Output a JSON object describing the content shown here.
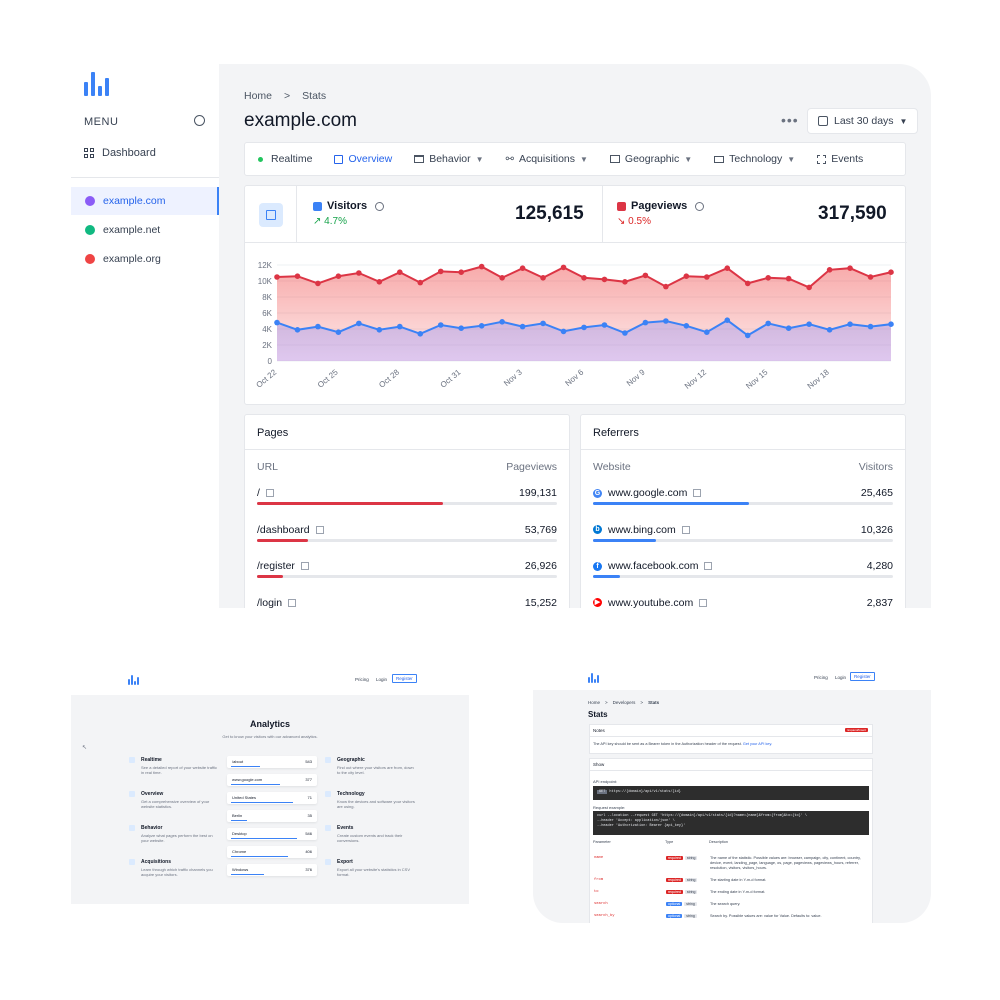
{
  "colors": {
    "accent": "#3b82f6",
    "visitors": "#3b82f6",
    "pageviews": "#dc3545",
    "panel_bg": "#f3f4f6"
  },
  "sidebar": {
    "menu_label": "MENU",
    "dashboard_label": "Dashboard",
    "sites": [
      {
        "label": "example.com",
        "color": "#8b5cf6",
        "active": true
      },
      {
        "label": "example.net",
        "color": "#10b981",
        "active": false
      },
      {
        "label": "example.org",
        "color": "#ef4444",
        "active": false
      }
    ]
  },
  "header": {
    "breadcrumb_home": "Home",
    "breadcrumb_sep": ">",
    "breadcrumb_current": "Stats",
    "title": "example.com",
    "more_label": "•••",
    "range_label": "Last 30 days"
  },
  "tabs": [
    {
      "label": "Realtime",
      "icon": "dot-icon",
      "dropdown": false
    },
    {
      "label": "Overview",
      "icon": "chart-icon",
      "dropdown": false
    },
    {
      "label": "Behavior",
      "icon": "window-icon",
      "dropdown": true
    },
    {
      "label": "Acquisitions",
      "icon": "share-icon",
      "dropdown": true
    },
    {
      "label": "Geographic",
      "icon": "map-icon",
      "dropdown": true
    },
    {
      "label": "Technology",
      "icon": "devices-icon",
      "dropdown": true
    },
    {
      "label": "Events",
      "icon": "target-icon",
      "dropdown": false
    }
  ],
  "stats": {
    "visitors": {
      "label": "Visitors",
      "change": "4.7%",
      "value": "125,615"
    },
    "pageviews": {
      "label": "Pageviews",
      "change": "0.5%",
      "value": "317,590"
    }
  },
  "chart_data": {
    "type": "area",
    "x": [
      "Oct 22",
      "Oct 23",
      "Oct 24",
      "Oct 25",
      "Oct 26",
      "Oct 27",
      "Oct 28",
      "Oct 29",
      "Oct 30",
      "Oct 31",
      "Nov 1",
      "Nov 2",
      "Nov 3",
      "Nov 4",
      "Nov 5",
      "Nov 6",
      "Nov 7",
      "Nov 8",
      "Nov 9",
      "Nov 10",
      "Nov 11",
      "Nov 12",
      "Nov 13",
      "Nov 14",
      "Nov 15",
      "Nov 16",
      "Nov 17",
      "Nov 18",
      "Nov 19",
      "Nov 20",
      "Nov 21"
    ],
    "x_tick_labels": [
      "Oct 22",
      "Oct 25",
      "Oct 28",
      "Oct 31",
      "Nov 3",
      "Nov 6",
      "Nov 9",
      "Nov 12",
      "Nov 15",
      "Nov 18"
    ],
    "y_tick_labels": [
      "0",
      "2K",
      "4K",
      "6K",
      "8K",
      "10K",
      "12K"
    ],
    "ylim": [
      0,
      12000
    ],
    "series": [
      {
        "name": "Pageviews",
        "color": "#dc3545",
        "values": [
          10500,
          10600,
          9700,
          10600,
          11000,
          9900,
          11100,
          9800,
          11200,
          11100,
          11800,
          10400,
          11600,
          10400,
          11700,
          10400,
          10200,
          9900,
          10700,
          9300,
          10600,
          10500,
          11600,
          9700,
          10400,
          10300,
          9200,
          11400,
          11600,
          10500,
          11100
        ]
      },
      {
        "name": "Visitors",
        "color": "#3b82f6",
        "values": [
          4800,
          3900,
          4300,
          3600,
          4700,
          3900,
          4300,
          3400,
          4500,
          4100,
          4400,
          4900,
          4300,
          4700,
          3700,
          4200,
          4500,
          3500,
          4800,
          5000,
          4400,
          3600,
          5100,
          3200,
          4700,
          4100,
          4600,
          3900,
          4600,
          4300,
          4600
        ]
      }
    ],
    "grid": true
  },
  "pages": {
    "title": "Pages",
    "col_left": "URL",
    "col_right": "Pageviews",
    "rows": [
      {
        "label": "/",
        "value": "199,131",
        "fraction": 0.62
      },
      {
        "label": "/dashboard",
        "value": "53,769",
        "fraction": 0.17
      },
      {
        "label": "/register",
        "value": "26,926",
        "fraction": 0.085
      },
      {
        "label": "/login",
        "value": "15,252",
        "fraction": 0.05
      }
    ]
  },
  "referrers": {
    "title": "Referrers",
    "col_left": "Website",
    "col_right": "Visitors",
    "rows": [
      {
        "label": "www.google.com",
        "value": "25,465",
        "fraction": 0.52,
        "icon": "google-icon",
        "color": "#4285f4",
        "glyph": "G"
      },
      {
        "label": "www.bing.com",
        "value": "10,326",
        "fraction": 0.21,
        "icon": "bing-icon",
        "color": "#0078d4",
        "glyph": "b"
      },
      {
        "label": "www.facebook.com",
        "value": "4,280",
        "fraction": 0.09,
        "icon": "facebook-icon",
        "color": "#1877f2",
        "glyph": "f"
      },
      {
        "label": "www.youtube.com",
        "value": "2,837",
        "fraction": 0.06,
        "icon": "youtube-icon",
        "color": "#ff0000",
        "glyph": "▶"
      }
    ]
  },
  "thumb_left": {
    "nav": {
      "pricing": "Pricing",
      "login": "Login",
      "register": "Register"
    },
    "title": "Analytics",
    "subtitle": "Get to know your visitors with our advanced analytics.",
    "features_left": [
      {
        "title": "Realtime",
        "desc": "See a detailed report of your website traffic in real time."
      },
      {
        "title": "Overview",
        "desc": "Get a comprehensive overview of your website statistics."
      },
      {
        "title": "Behavior",
        "desc": "Analyze what pages perform the best on your website."
      },
      {
        "title": "Acquisitions",
        "desc": "Learn through which traffic channels you acquire your visitors."
      }
    ],
    "features_right": [
      {
        "title": "Geographic",
        "desc": "Find out where your visitors are from, down to the city level."
      },
      {
        "title": "Technology",
        "desc": "Know the devices and software your visitors are using."
      },
      {
        "title": "Events",
        "desc": "Create custom events and track their conversions."
      },
      {
        "title": "Export",
        "desc": "Export all your website's statistics in CSV format."
      }
    ],
    "items": [
      {
        "label": "/about",
        "value": "543",
        "fraction": 0.35
      },
      {
        "label": "www.google.com",
        "value": "377",
        "fraction": 0.6
      },
      {
        "label": "United States",
        "value": "71",
        "fraction": 0.75
      },
      {
        "label": "Berlin",
        "value": "35",
        "fraction": 0.2
      },
      {
        "label": "Desktop",
        "value": "546",
        "fraction": 0.8
      },
      {
        "label": "Chrome",
        "value": "406",
        "fraction": 0.7
      },
      {
        "label": "Windows",
        "value": "376",
        "fraction": 0.4
      }
    ]
  },
  "thumb_right": {
    "nav": {
      "pricing": "Pricing",
      "login": "Login",
      "register": "Register"
    },
    "crumb_home": "Home",
    "crumb_sep": ">",
    "crumb_dev": "Developers",
    "crumb_current": "Stats",
    "title": "Stats",
    "notes_title": "Notes",
    "notes_badge": "Expand/Insert",
    "notes_text": "The API key should be sent as a Bearer token in the Authorization header of the request.",
    "notes_link": "Get your API key.",
    "show_title": "Show",
    "endpoint_label": "API endpoint:",
    "endpoint_method": "GET",
    "endpoint_url": "https://{domain}/api/v1/stats/{id}",
    "request_label": "Request example:",
    "request_lines": [
      "curl --location --request GET 'https://{domain}/api/v1/stats/{id}?name={name}&from={from}&to={to}' \\",
      "--header 'Accept: application/json' \\",
      "--header 'Authorization: Bearer {api_key}'"
    ],
    "col_param": "Parameter",
    "col_type": "Type",
    "col_desc": "Description",
    "params": [
      {
        "name": "name",
        "req": "required",
        "type": "string",
        "desc": "The name of the statistic. Possible values are: browser, campaign, city, continent, country, device, event, landing_page, language, os, page, pageviews, pageviews_hours, referrer, resolution, visitors, visitors_hours."
      },
      {
        "name": "from",
        "req": "required",
        "type": "string",
        "desc": "The starting date in Y-m-d format."
      },
      {
        "name": "to",
        "req": "required",
        "type": "string",
        "desc": "The ending date in Y-m-d format."
      },
      {
        "name": "search",
        "req": "optional",
        "type": "string",
        "desc": "The search query."
      },
      {
        "name": "search_by",
        "req": "optional",
        "type": "string",
        "desc": "Search by. Possible values are: value for Value. Defaults to: value."
      }
    ]
  }
}
